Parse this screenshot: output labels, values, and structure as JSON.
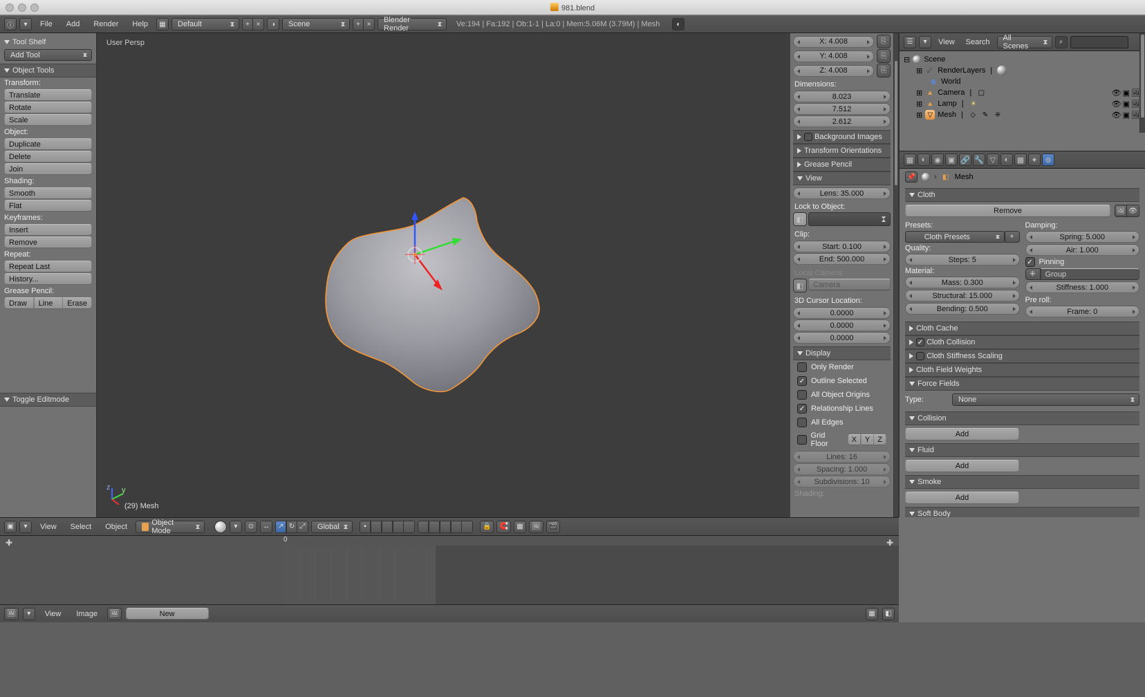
{
  "titlebar": {
    "filename": "981.blend"
  },
  "topbar": {
    "menus": {
      "file": "File",
      "add": "Add",
      "render": "Render",
      "help": "Help"
    },
    "layout": "Default",
    "scene": "Scene",
    "engine": "Blender Render",
    "status": "Ve:194 | Fa:192 | Ob:1-1 | La:0 | Mem:5.06M (3.79M) | Mesh"
  },
  "tool_shelf": {
    "title": "Tool Shelf",
    "add_tool": "Add Tool",
    "object_tools": "Object Tools",
    "transform_label": "Transform:",
    "translate": "Translate",
    "rotate": "Rotate",
    "scale": "Scale",
    "object_label": "Object:",
    "duplicate": "Duplicate",
    "delete": "Delete",
    "join": "Join",
    "shading_label": "Shading:",
    "smooth": "Smooth",
    "flat": "Flat",
    "keyframes_label": "Keyframes:",
    "insert": "Insert",
    "remove": "Remove",
    "repeat_label": "Repeat:",
    "repeat_last": "Repeat Last",
    "history": "History...",
    "gp_label": "Grease Pencil:",
    "draw": "Draw",
    "line": "Line",
    "erase": "Erase",
    "toggle_edit": "Toggle Editmode"
  },
  "viewport": {
    "persp": "User Persp",
    "mesh_footer": "(29) Mesh",
    "view": "View",
    "select": "Select",
    "object": "Object",
    "mode": "Object Mode",
    "orient": "Global"
  },
  "npanel": {
    "scale_x": "X: 4.008",
    "scale_y": "Y: 4.008",
    "scale_z": "Z: 4.008",
    "dim_label": "Dimensions:",
    "dim_x": "8.023",
    "dim_y": "7.512",
    "dim_z": "2.612",
    "bg": "Background Images",
    "to": "Transform Orientations",
    "gp": "Grease Pencil",
    "view": "View",
    "lens": "Lens: 35.000",
    "lock": "Lock to Object:",
    "clip": "Clip:",
    "clip_s": "Start: 0.100",
    "clip_e": "End: 500.000",
    "localcam": "Local Camera:",
    "camera": "Camera",
    "cursor": "3D Cursor Location:",
    "cx": "0.0000",
    "cy": "0.0000",
    "cz": "0.0000",
    "display": "Display",
    "only_render": "Only Render",
    "outline": "Outline Selected",
    "all_origins": "All Object Origins",
    "rel": "Relationship Lines",
    "edges": "All Edges",
    "grid": "Grid Floor",
    "gx": "X",
    "gy": "Y",
    "gz": "Z",
    "lines": "Lines: 16",
    "spacing": "Spacing: 1.000",
    "subdiv": "Subdivisions: 10",
    "shading": "Shading:"
  },
  "outliner": {
    "view": "View",
    "search": "Search",
    "filter": "All Scenes",
    "scene": "Scene",
    "renderlayers": "RenderLayers",
    "world": "World",
    "camera": "Camera",
    "lamp": "Lamp",
    "mesh": "Mesh"
  },
  "properties": {
    "breadcrumb": "Mesh",
    "cloth": "Cloth",
    "remove": "Remove",
    "presets_label": "Presets:",
    "presets": "Cloth Presets",
    "damping": "Damping:",
    "spring": "Spring: 5.000",
    "air": "Air: 1.000",
    "quality": "Quality:",
    "steps": "Steps: 5",
    "pinning": "Pinning",
    "group": "Group",
    "material": "Material:",
    "mass": "Mass: 0.300",
    "stiffness": "Stiffness: 1.000",
    "structural": "Structural: 15.000",
    "preroll": "Pre roll:",
    "frame": "Frame: 0",
    "bending": "Bending: 0.500",
    "cache": "Cloth Cache",
    "collision_panel": "Cloth Collision",
    "stiff_scaling": "Cloth Stiffness Scaling",
    "field_weights": "Cloth Field Weights",
    "force_fields": "Force Fields",
    "type": "Type:",
    "none": "None",
    "collision": "Collision",
    "fluid": "Fluid",
    "smoke": "Smoke",
    "softbody": "Soft Body",
    "add": "Add"
  },
  "timeline": {
    "zero": "0"
  },
  "bottom": {
    "view": "View",
    "image": "Image",
    "new": "New"
  }
}
